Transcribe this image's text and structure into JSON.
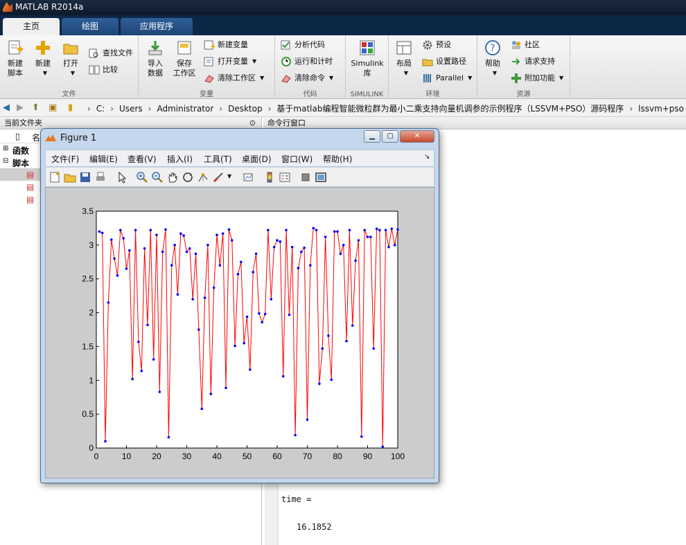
{
  "app": {
    "title": "MATLAB R2014a"
  },
  "tabs": [
    "主页",
    "绘图",
    "应用程序"
  ],
  "ribbon": {
    "groups": {
      "file": "文件",
      "variable": "变量",
      "code": "代码",
      "simulink": "SIMULINK",
      "env": "环境",
      "resources": "资源"
    },
    "new_script": [
      "新建",
      "脚本"
    ],
    "new": "新建",
    "open": "打开",
    "find_files": "查找文件",
    "compare": "比较",
    "import": [
      "导入",
      "数据"
    ],
    "save_ws": [
      "保存",
      "工作区"
    ],
    "new_var": "新建变量",
    "open_var": "打开变量",
    "clear_ws": "清除工作区",
    "analyze": "分析代码",
    "run_time": "运行和计时",
    "clear_cmd": "清除命令",
    "simulink": [
      "Simulink",
      "库"
    ],
    "layout": "布局",
    "prefs": "预设",
    "set_path": "设置路径",
    "parallel": "Parallel",
    "help": "帮助",
    "community": "社区",
    "support": "请求支持",
    "addons": "附加功能"
  },
  "address": {
    "crumbs": [
      "C:",
      "Users",
      "Administrator",
      "Desktop",
      "基于matlab编程智能微粒群为最小二乘支持向量机调参的示例程序（LSSVM+PSO）源码程序",
      "lssvm+pso"
    ]
  },
  "left_panel": {
    "title": "当前文件夹",
    "col_name": "名",
    "tree": [
      "函数",
      "脚本"
    ]
  },
  "command_window": {
    "title": "命令行窗口",
    "var_line": "time =",
    "value_line": "16.1852"
  },
  "figure": {
    "title": "Figure 1",
    "menus": [
      "文件(F)",
      "编辑(E)",
      "查看(V)",
      "插入(I)",
      "工具(T)",
      "桌面(D)",
      "窗口(W)",
      "帮助(H)"
    ],
    "xticks": [
      "0",
      "10",
      "20",
      "30",
      "40",
      "50",
      "60",
      "70",
      "80",
      "90",
      "100"
    ],
    "yticks": [
      "0",
      "0.5",
      "1",
      "1.5",
      "2",
      "2.5",
      "3",
      "3.5"
    ]
  },
  "colors": {
    "line": "#ff0000",
    "marker": "#0000ff",
    "title_bar": "#0d1a2b",
    "ribbon_tab": "#1e4677"
  },
  "chart_data": {
    "type": "line",
    "xlim": [
      0,
      100
    ],
    "ylim": [
      0,
      3.5
    ],
    "grid": false,
    "title": "",
    "xlabel": "",
    "ylabel": "",
    "series": [
      {
        "style": "red line with blue point markers",
        "x": [
          1,
          2,
          3,
          4,
          5,
          6,
          7,
          8,
          9,
          10,
          11,
          12,
          13,
          14,
          15,
          16,
          17,
          18,
          19,
          20,
          21,
          22,
          23,
          24,
          25,
          26,
          27,
          28,
          29,
          30,
          31,
          32,
          33,
          34,
          35,
          36,
          37,
          38,
          39,
          40,
          41,
          42,
          43,
          44,
          45,
          46,
          47,
          48,
          49,
          50,
          51,
          52,
          53,
          54,
          55,
          56,
          57,
          58,
          59,
          60,
          61,
          62,
          63,
          64,
          65,
          66,
          67,
          68,
          69,
          70,
          71,
          72,
          73,
          74,
          75,
          76,
          77,
          78,
          79,
          80,
          81,
          82,
          83,
          84,
          85,
          86,
          87,
          88,
          89,
          90,
          91,
          92,
          93,
          94,
          95,
          96,
          97,
          98,
          99,
          100
        ],
        "y": [
          3.2,
          3.18,
          0.1,
          2.15,
          3.08,
          2.8,
          2.55,
          3.22,
          3.1,
          2.65,
          2.92,
          1.02,
          3.22,
          1.57,
          1.14,
          2.95,
          1.82,
          3.22,
          1.31,
          3.15,
          0.83,
          2.9,
          3.23,
          0.16,
          2.7,
          3.0,
          2.27,
          3.17,
          3.14,
          2.9,
          2.95,
          2.2,
          2.87,
          1.75,
          0.58,
          2.22,
          3.0,
          0.8,
          2.37,
          3.15,
          2.7,
          3.17,
          0.89,
          3.23,
          3.07,
          1.51,
          2.57,
          2.75,
          1.55,
          1.94,
          1.16,
          2.6,
          2.87,
          1.99,
          1.86,
          1.98,
          3.22,
          2.2,
          2.97,
          3.07,
          3.05,
          1.06,
          3.22,
          1.97,
          2.97,
          0.19,
          2.66,
          2.9,
          2.96,
          0.42,
          2.7,
          3.25,
          3.22,
          0.95,
          1.47,
          3.12,
          1.66,
          1.01,
          3.2,
          3.2,
          2.87,
          3.0,
          1.58,
          3.22,
          1.81,
          2.77,
          3.07,
          0.17,
          3.22,
          3.12,
          3.12,
          1.47,
          3.24,
          3.22,
          0.02,
          3.22,
          2.97,
          3.24,
          3.0,
          3.23
        ]
      }
    ]
  }
}
